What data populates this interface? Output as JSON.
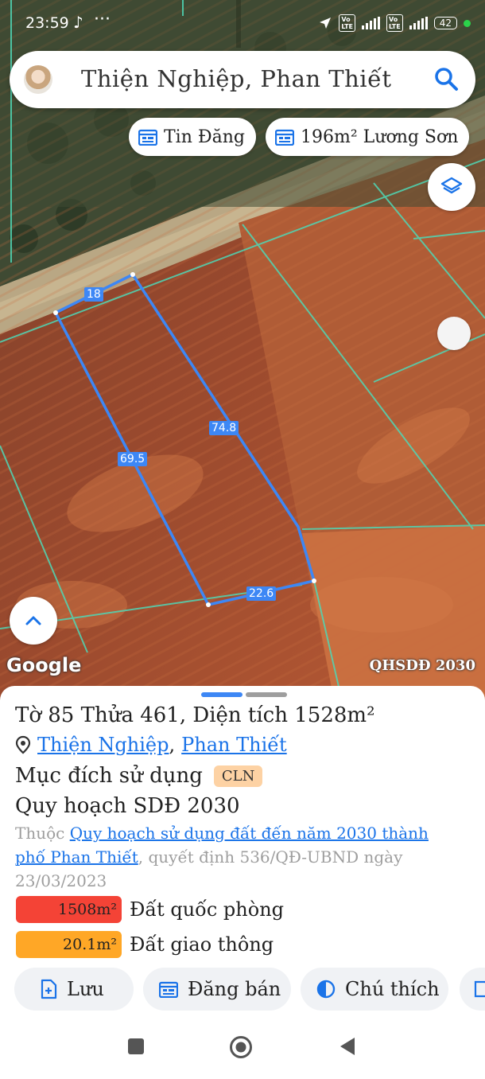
{
  "status_bar": {
    "time": "23:59",
    "battery": "42"
  },
  "search": {
    "title": "Thiện Nghiệp, Phan Thiết"
  },
  "chips": [
    {
      "label": "Tin Đăng",
      "icon": "calendar-icon"
    },
    {
      "label": "196m² Lương Sơn",
      "icon": "calendar-icon"
    }
  ],
  "map": {
    "dimensions": [
      "18",
      "74.8",
      "69.5",
      "22.6"
    ],
    "logo": "Google",
    "source": "QHSDĐ 2030",
    "colors": {
      "parcel_outline": "#3d87f5",
      "boundary": "#4fd7b6"
    }
  },
  "parcel": {
    "title": "Tờ 85 Thửa 461, Diện tích 1528m²",
    "commune": "Thiện Nghiệp",
    "separator": ",",
    "city": "Phan Thiết",
    "purpose_label": "Mục đích sử dụng",
    "purpose_code": "CLN",
    "plan_title": "Quy hoạch SDĐ 2030",
    "plan_prefix": "Thuộc ",
    "plan_link": "Quy hoạch sử dụng đất đến năm 2030 thành phố Phan Thiết",
    "plan_suffix": ", quyết định 536/QĐ-UBND ngày 23/03/2023"
  },
  "land_use": [
    {
      "area": "1508m²",
      "label": "Đất quốc phòng",
      "color": "#f44336"
    },
    {
      "area": "20.1m²",
      "label": "Đất giao thông",
      "color": "#ffa726"
    }
  ],
  "actions": {
    "save": "Lưu",
    "post": "Đăng bán",
    "legend": "Chú thích"
  }
}
